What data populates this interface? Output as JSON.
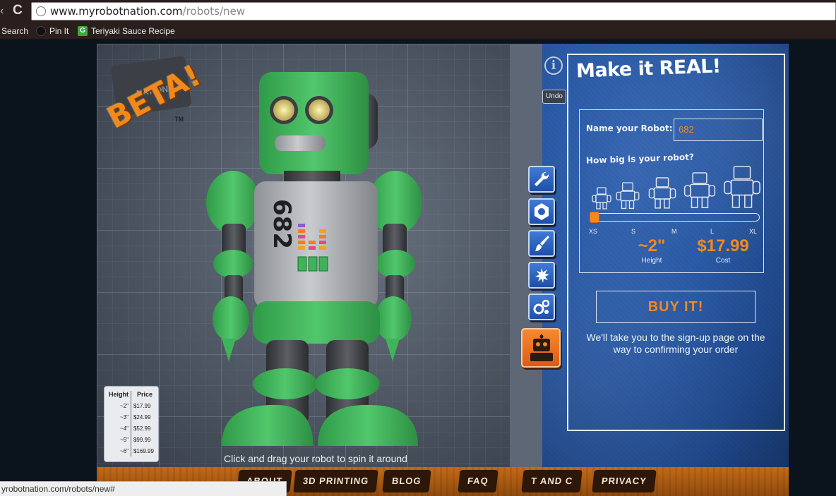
{
  "browser": {
    "url_host": "www.myrobotnation.com",
    "url_path": "/robots/new",
    "bookmarks": [
      "Search",
      "Pin It",
      "Teriyaki Sauce Recipe"
    ],
    "status_url": "yrobotnation.com/robots/new#"
  },
  "logo": {
    "beta": "BETA!",
    "sign_text": "NATION",
    "tm": "TM"
  },
  "robot": {
    "body_number": "682"
  },
  "stage": {
    "undo_label": "Undo",
    "info_label": "i",
    "hint": "Click and drag your robot to spin it around",
    "tools": [
      "wrench-icon",
      "nut-icon",
      "paintbrush-icon",
      "splat-icon",
      "gears-icon",
      "robot-icon"
    ]
  },
  "price_table": {
    "headers": [
      "Height",
      "Price"
    ],
    "rows": [
      [
        "~2\"",
        "$17.99"
      ],
      [
        "~3\"",
        "$24.99"
      ],
      [
        "~4\"",
        "$52.99"
      ],
      [
        "~5\"",
        "$99.99"
      ],
      [
        "~6\"",
        "$169.99"
      ]
    ]
  },
  "order": {
    "title": "Make it REAL!",
    "name_label": "Name your Robot:",
    "name_value": "682",
    "size_label": "How big is your robot?",
    "sizes": [
      "XS",
      "S",
      "M",
      "L",
      "XL"
    ],
    "height_value": "~2\"",
    "height_label": "Height",
    "cost_value": "$17.99",
    "cost_label": "Cost",
    "buy_label": "BUY IT!",
    "buy_note": "We'll take you to the sign-up page on the way to confirming your order"
  },
  "footer_nav": [
    "ABOUT",
    "3D PRINTING",
    "BLOG",
    "FAQ",
    "T AND C",
    "PRIVACY"
  ],
  "colors": {
    "accent": "#f5891e",
    "robot_green": "#3fb35a",
    "blueprint": "#2a5aa6",
    "tool_blue": "#2e63c2"
  }
}
